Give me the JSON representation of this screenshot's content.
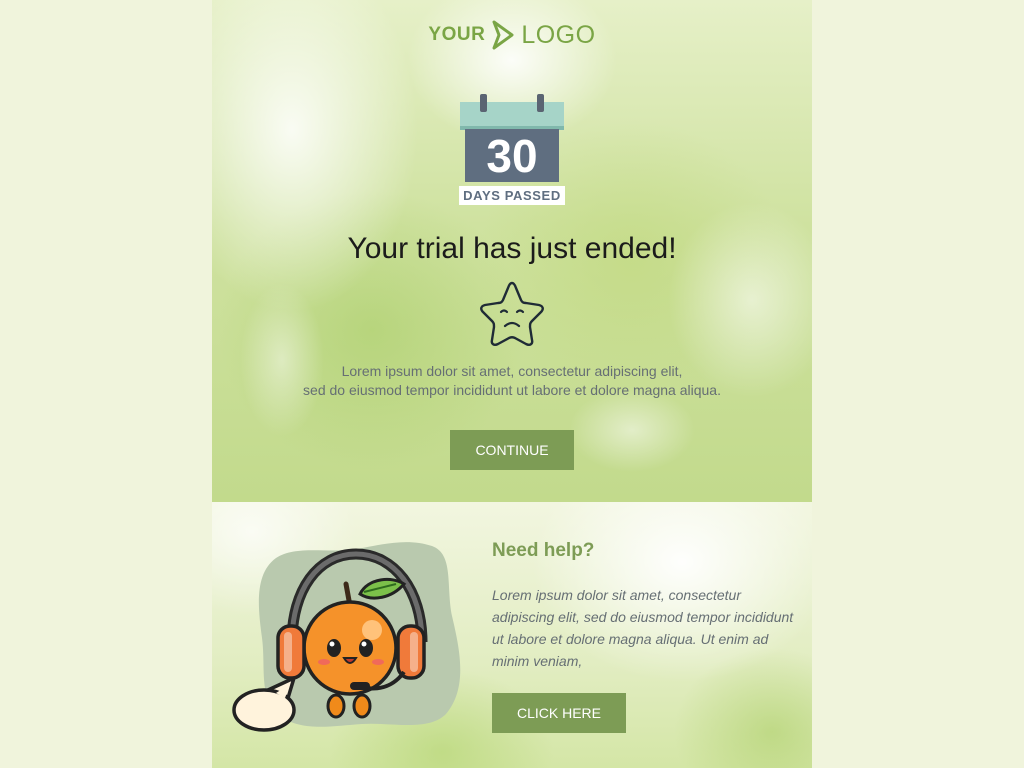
{
  "logo": {
    "part1": "YOUR",
    "part2": "LOGO",
    "icon": "chevron-arrow-icon"
  },
  "calendar": {
    "day": "30",
    "label": "DAYS PASSED",
    "icon": "calendar-icon"
  },
  "headline": "Your trial has just ended!",
  "star_icon": "sad-star-icon",
  "body": {
    "line1": "Lorem ipsum dolor sit amet, consectetur adipiscing elit,",
    "line2": "sed do eiusmod tempor incididunt ut labore et dolore magna aliqua."
  },
  "continue_label": "CONTINUE",
  "help": {
    "title": "Need help?",
    "text": "Lorem ipsum dolor sit amet, consectetur adipiscing elit, sed do eiusmod tempor incididunt ut labore et dolore magna aliqua. Ut enim ad minim veniam,",
    "button_label": "CLICK HERE",
    "illustration": "orange-support-mascot"
  },
  "colors": {
    "accent": "#7d9c55",
    "logo": "#7aa545",
    "calendar_dark": "#5f6e80",
    "calendar_top": "#a6d4c8",
    "text_muted": "#666f74",
    "headline": "#1b1b1b"
  }
}
